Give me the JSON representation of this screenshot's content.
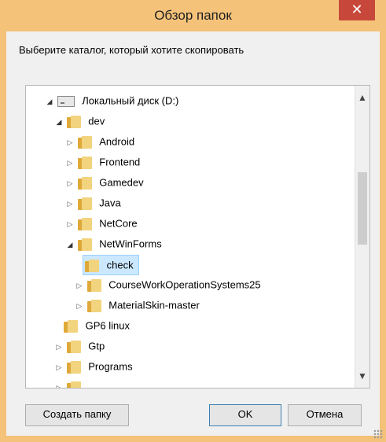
{
  "window": {
    "title": "Обзор папок",
    "close_glyph": "✕",
    "description": "Выберите каталог, который хотите скопировать"
  },
  "tree": {
    "items": [
      {
        "label": "Локальный диск (D:)",
        "icon": "drive-icon",
        "expanded": true
      },
      {
        "label": "dev",
        "icon": "folder-icon",
        "expanded": true
      },
      {
        "label": "Android",
        "icon": "folder-icon",
        "expanded": false
      },
      {
        "label": "Frontend",
        "icon": "folder-icon",
        "expanded": false
      },
      {
        "label": "Gamedev",
        "icon": "folder-icon",
        "expanded": false
      },
      {
        "label": "Java",
        "icon": "folder-icon",
        "expanded": false
      },
      {
        "label": "NetCore",
        "icon": "folder-icon",
        "expanded": false
      },
      {
        "label": "NetWinForms",
        "icon": "folder-icon",
        "expanded": true
      },
      {
        "label": "check",
        "icon": "folder-icon",
        "selected": true
      },
      {
        "label": "CourseWorkOperationSystems25",
        "icon": "folder-icon",
        "expanded": false
      },
      {
        "label": "MaterialSkin-master",
        "icon": "folder-icon",
        "expanded": false
      },
      {
        "label": "GP6 linux",
        "icon": "folder-icon"
      },
      {
        "label": "Gtp",
        "icon": "folder-icon",
        "expanded": false
      },
      {
        "label": "Programs",
        "icon": "folder-icon",
        "expanded": false
      },
      {
        "label": "",
        "icon": "folder-icon",
        "expanded": false
      }
    ]
  },
  "buttons": {
    "new_folder": "Создать папку",
    "ok": "OK",
    "cancel": "Отмена"
  },
  "colors": {
    "frame": "#f5c27a",
    "close": "#c7483a",
    "selection": "#cce8ff"
  }
}
